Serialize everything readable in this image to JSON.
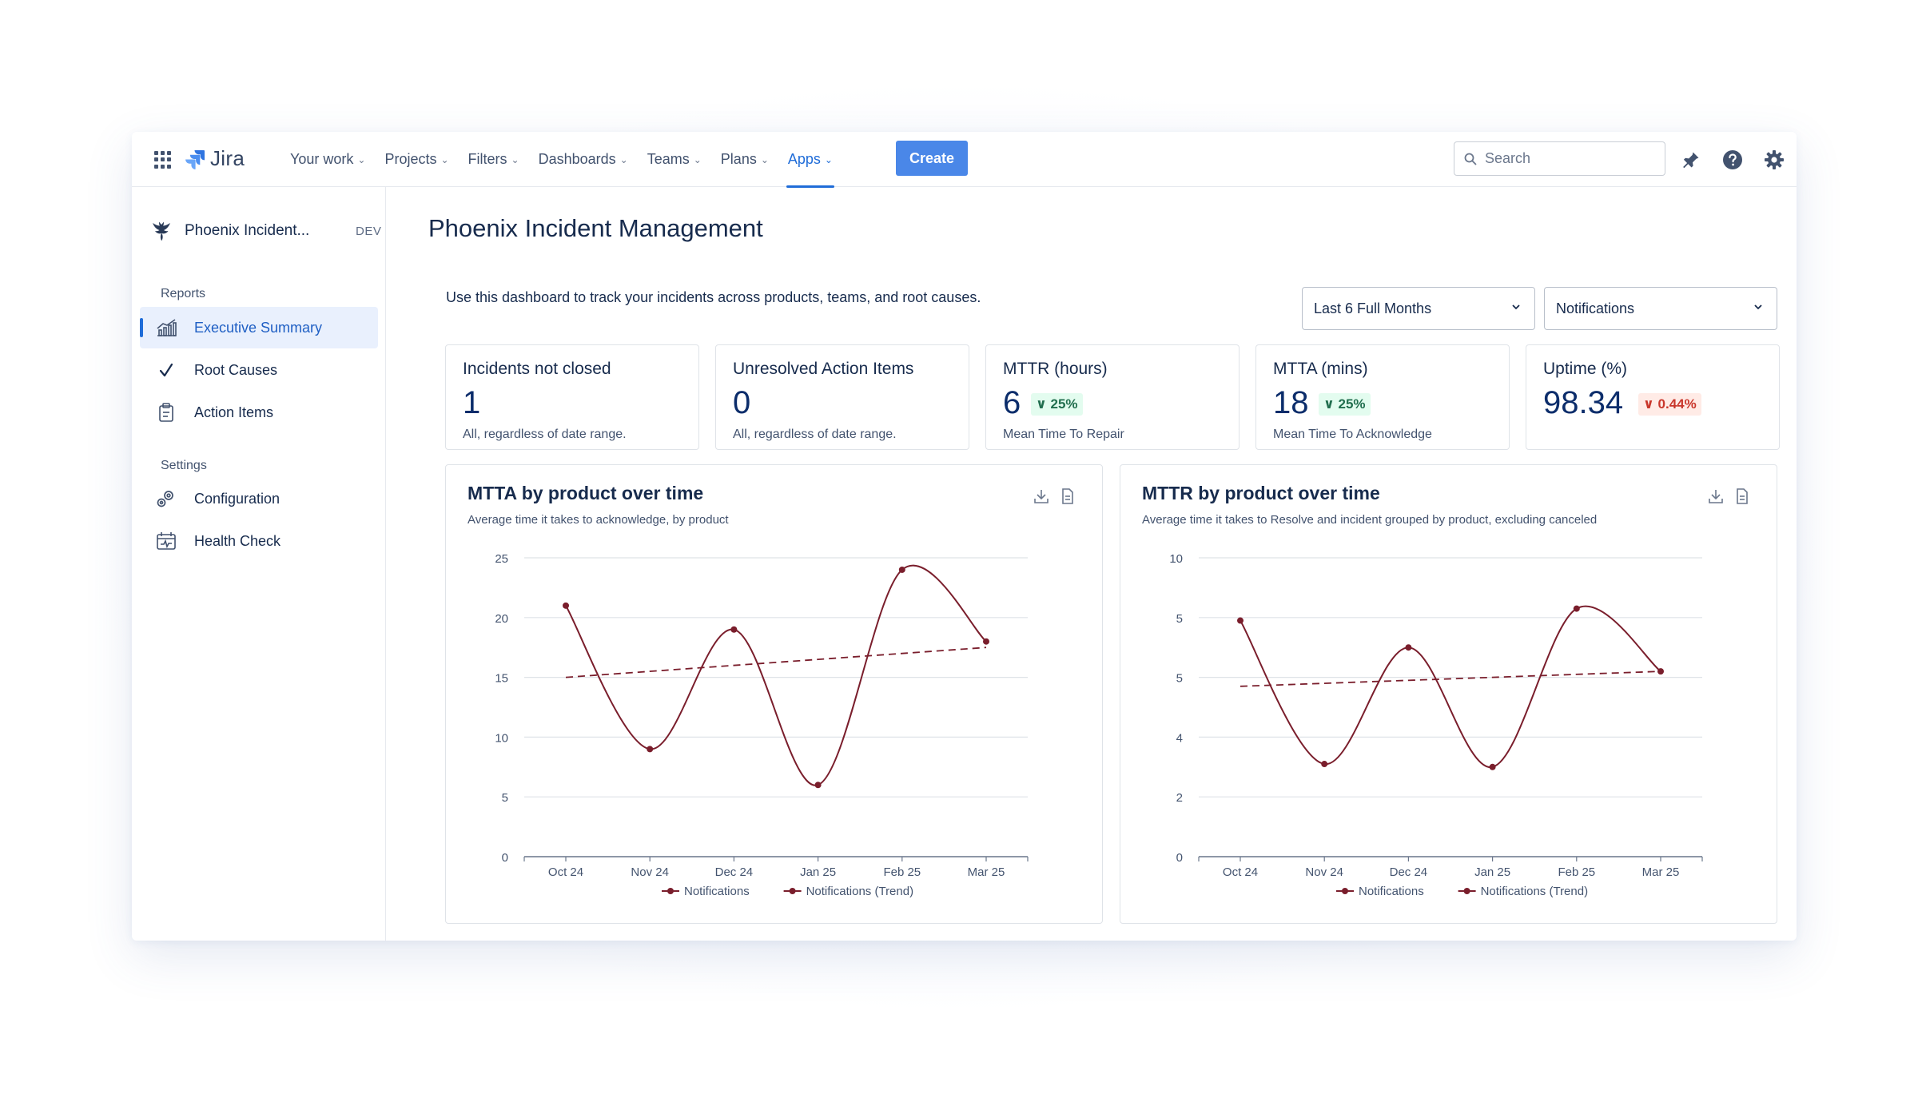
{
  "app": {
    "logo_text": "Jira",
    "nav": [
      {
        "label": "Your work"
      },
      {
        "label": "Projects"
      },
      {
        "label": "Filters"
      },
      {
        "label": "Dashboards"
      },
      {
        "label": "Teams"
      },
      {
        "label": "Plans"
      },
      {
        "label": "Apps",
        "active": true
      }
    ],
    "create_label": "Create",
    "search_placeholder": "Search"
  },
  "sidebar": {
    "project_name": "Phoenix Incident...",
    "project_tag": "DEV",
    "sections": [
      {
        "label": "Reports",
        "items": [
          {
            "label": "Executive Summary",
            "icon": "chart-icon",
            "active": true
          },
          {
            "label": "Root Causes",
            "icon": "check-icon"
          },
          {
            "label": "Action Items",
            "icon": "clipboard-icon"
          }
        ]
      },
      {
        "label": "Settings",
        "items": [
          {
            "label": "Configuration",
            "icon": "gears-icon"
          },
          {
            "label": "Health Check",
            "icon": "calendar-icon"
          }
        ]
      }
    ]
  },
  "main": {
    "title": "Phoenix Incident Management",
    "description": "Use this dashboard to track your incidents across products, teams, and root causes.",
    "date_filter": "Last 6 Full Months",
    "product_filter": "Notifications"
  },
  "kpis": [
    {
      "title": "Incidents not closed",
      "value": "1",
      "delta": "",
      "delta_type": "",
      "sub": "All, regardless of date range."
    },
    {
      "title": "Unresolved Action Items",
      "value": "0",
      "delta": "",
      "delta_type": "",
      "sub": "All, regardless of date range."
    },
    {
      "title": "MTTR (hours)",
      "value": "6",
      "delta": "∨ 25%",
      "delta_type": "good",
      "sub": "Mean Time To Repair"
    },
    {
      "title": "MTTA (mins)",
      "value": "18",
      "delta": "∨ 25%",
      "delta_type": "good",
      "sub": "Mean Time To Acknowledge"
    },
    {
      "title": "Uptime (%)",
      "value": "98.34",
      "delta": "∨ 0.44%",
      "delta_type": "bad",
      "sub": ""
    }
  ],
  "colors": {
    "series": "#7a1e2c",
    "accent": "#1f6cd8",
    "create": "#4a87e8"
  },
  "chart_data": [
    {
      "type": "line",
      "title": "MTTA by product over time",
      "subtitle": "Average time it takes to acknowledge, by product",
      "ylabel": "",
      "x": [
        "Oct 24",
        "Nov 24",
        "Dec 24",
        "Jan 25",
        "Feb 25",
        "Mar 25"
      ],
      "yticks": [
        "0",
        "5",
        "10",
        "15",
        "20",
        "25"
      ],
      "ylim": [
        0,
        25
      ],
      "grid": true,
      "legend_position": "bottom",
      "series": [
        {
          "name": "Notifications",
          "values": [
            21,
            9,
            19,
            6,
            24,
            18
          ]
        },
        {
          "name": "Notifications (Trend)",
          "dashed": true,
          "values": [
            15,
            15.5,
            16,
            16.5,
            17,
            17.5
          ]
        }
      ]
    },
    {
      "type": "line",
      "title": "MTTR by product over time",
      "subtitle": "Average time it takes to Resolve and incident grouped by product, excluding canceled",
      "ylabel": "",
      "x": [
        "Oct 24",
        "Nov 24",
        "Dec 24",
        "Jan 25",
        "Feb 25",
        "Mar 25"
      ],
      "yticks": [
        "0",
        "2",
        "4",
        "5",
        "5",
        "10"
      ],
      "ylim": [
        0,
        5
      ],
      "grid": true,
      "legend_position": "bottom",
      "series": [
        {
          "name": "Notifications",
          "values": [
            3.95,
            1.55,
            3.5,
            1.5,
            4.15,
            3.1
          ]
        },
        {
          "name": "Notifications (Trend)",
          "dashed": true,
          "values": [
            2.85,
            2.9,
            2.95,
            3.0,
            3.05,
            3.1
          ]
        }
      ]
    }
  ]
}
